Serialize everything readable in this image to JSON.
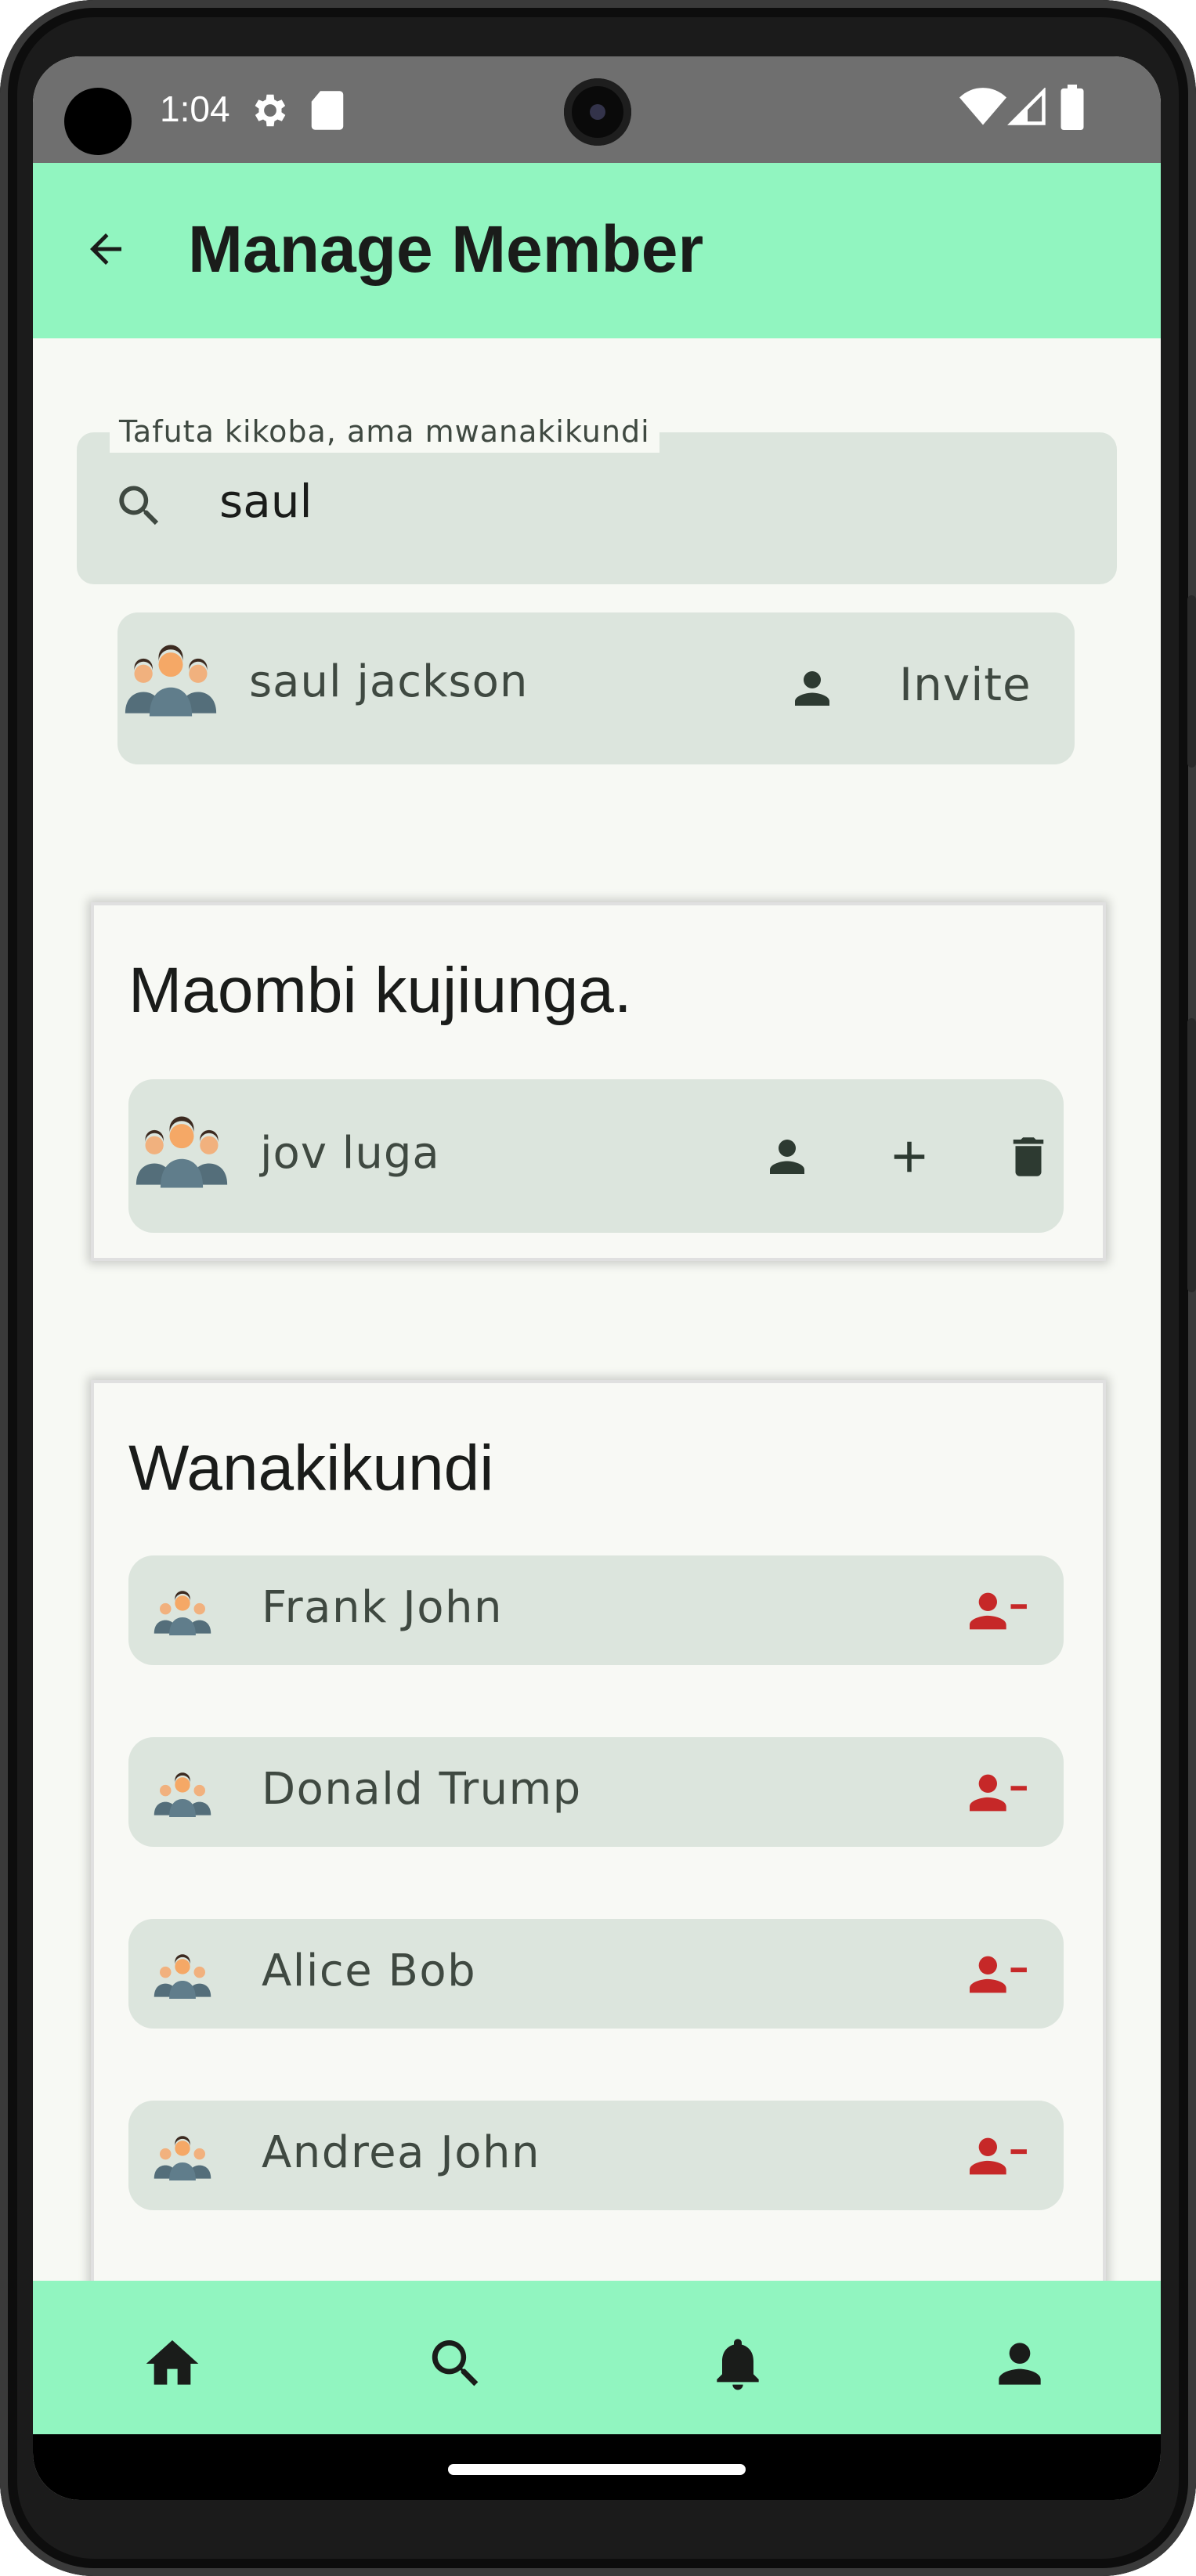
{
  "status_bar": {
    "time": "1:04",
    "icons": [
      "settings-icon",
      "sd-card-icon",
      "wifi-icon",
      "signal-icon",
      "battery-icon"
    ]
  },
  "app_bar": {
    "title": "Manage Member",
    "back_icon": "arrow-left-icon"
  },
  "search": {
    "label": "Tafuta kikoba, ama mwanakikundi",
    "value": "saul"
  },
  "search_result": {
    "name": "saul jackson",
    "action": "Invite"
  },
  "requests": {
    "title": "Maombi kujiunga.",
    "items": [
      {
        "name": "jov luga",
        "actions": [
          "person-icon",
          "plus-icon",
          "delete-icon"
        ]
      }
    ]
  },
  "members": {
    "title": "Wanakikundi",
    "items": [
      {
        "name": "Frank John"
      },
      {
        "name": "Donald Trump"
      },
      {
        "name": "Alice Bob"
      },
      {
        "name": "Andrea John"
      }
    ]
  },
  "bottom_nav": [
    "home-icon",
    "search-icon",
    "bell-icon",
    "person-icon"
  ],
  "colors": {
    "accent": "#91f5c0",
    "card": "#dce5dd",
    "danger": "#c62828",
    "background": "#f7f9f4"
  }
}
